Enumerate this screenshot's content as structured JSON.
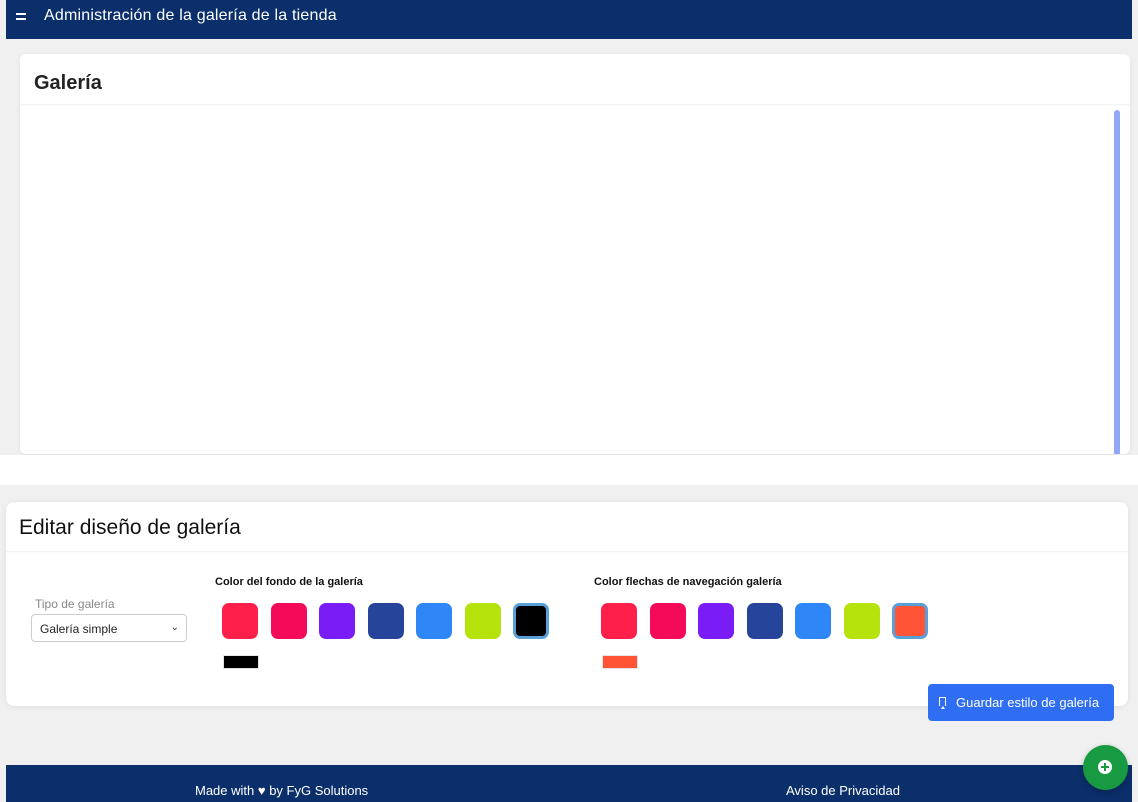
{
  "header": {
    "title": "Administración de la galería de la tienda",
    "menu_icon": "hamburger-menu-icon"
  },
  "gallery": {
    "title": "Galería"
  },
  "design": {
    "title": "Editar diseño de galería",
    "type_label": "Tipo de galería",
    "type_value": "Galería simple",
    "background": {
      "label": "Color del fondo de la galería",
      "swatches": [
        "#ff1f4b",
        "#f50a5a",
        "#7a1cf5",
        "#25449a",
        "#2f86f6",
        "#b5e30b",
        "#000000"
      ],
      "selected": "#000000"
    },
    "arrows": {
      "label": "Color flechas de navegación galería",
      "swatches": [
        "#ff1f4b",
        "#f50a5a",
        "#7a1cf5",
        "#25449a",
        "#2f86f6",
        "#b5e30b",
        "#ff5436"
      ],
      "selected": "#ff5436"
    },
    "save_label": "Guardar estilo de galería",
    "save_icon": "bookmark-icon"
  },
  "footer": {
    "made_with": "Made with ♥ by FyG Solutions",
    "privacy": "Aviso de Privacidad"
  },
  "fab": {
    "icon": "plus-circle-icon"
  },
  "colors": {
    "navbar": "#0b2f6b",
    "primary_button": "#2f6ef2",
    "fab": "#179a41",
    "scrollbar": "#8fa9f7"
  }
}
